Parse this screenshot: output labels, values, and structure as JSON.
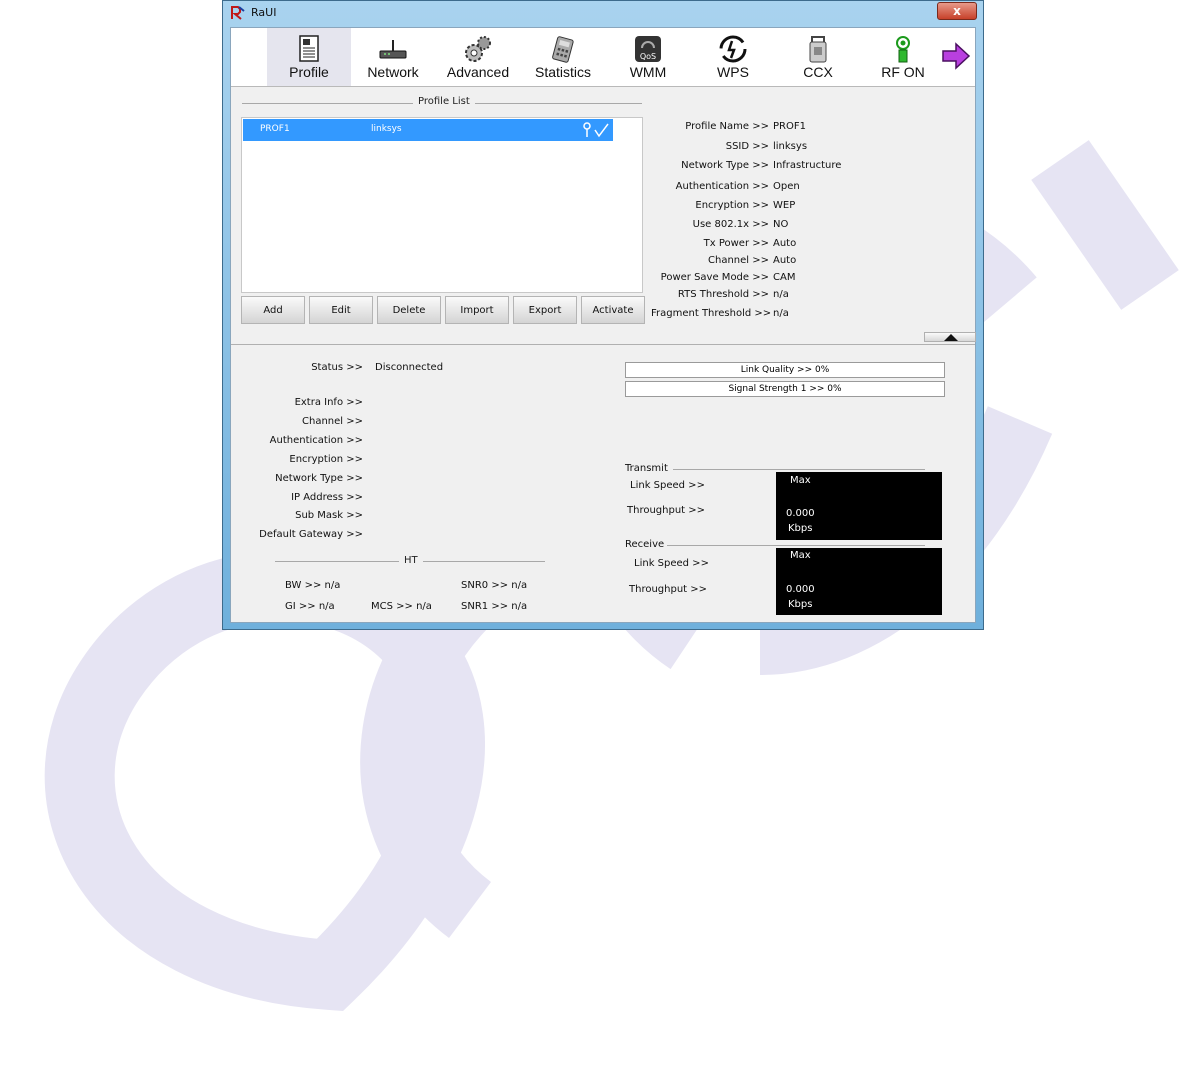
{
  "window": {
    "title": "RaUI",
    "close_glyph": "x"
  },
  "toolbar": [
    {
      "label": "Profile",
      "icon": "profile-icon",
      "active": true
    },
    {
      "label": "Network",
      "icon": "network-icon"
    },
    {
      "label": "Advanced",
      "icon": "advanced-icon"
    },
    {
      "label": "Statistics",
      "icon": "statistics-icon"
    },
    {
      "label": "WMM",
      "icon": "wmm-icon"
    },
    {
      "label": "WPS",
      "icon": "wps-icon"
    },
    {
      "label": "CCX",
      "icon": "ccx-icon"
    },
    {
      "label": "RF ON",
      "icon": "rf-on-icon"
    }
  ],
  "profile_list": {
    "title": "Profile List",
    "rows": [
      {
        "name": "PROF1",
        "ssid": "linksys"
      }
    ],
    "buttons": [
      "Add",
      "Edit",
      "Delete",
      "Import",
      "Export",
      "Activate"
    ]
  },
  "profile_details": [
    {
      "key": "Profile Name >>",
      "value": "PROF1"
    },
    {
      "key": "SSID >>",
      "value": "linksys"
    },
    {
      "key": "Network Type >>",
      "value": "Infrastructure"
    },
    {
      "key": "Authentication >>",
      "value": "Open"
    },
    {
      "key": "Encryption >>",
      "value": "WEP"
    },
    {
      "key": "Use 802.1x >>",
      "value": "NO"
    },
    {
      "key": "Tx Power >>",
      "value": "Auto"
    },
    {
      "key": "Channel >>",
      "value": "Auto"
    },
    {
      "key": "Power Save Mode >>",
      "value": "CAM"
    },
    {
      "key": "RTS Threshold >>",
      "value": "n/a"
    },
    {
      "key": "Fragment Threshold >>",
      "value": "n/a"
    }
  ],
  "status": {
    "status_label": "Status >>",
    "status_value": "Disconnected",
    "labels": [
      "Extra Info >>",
      "Channel >>",
      "Authentication >>",
      "Encryption >>",
      "Network Type >>",
      "IP Address >>",
      "Sub Mask >>",
      "Default Gateway >>"
    ]
  },
  "ht": {
    "title": "HT",
    "bw": "BW >> n/a",
    "snr0": "SNR0 >>  n/a",
    "gi": "GI >>  n/a",
    "mcs": "MCS >>  n/a",
    "snr1": "SNR1 >>  n/a"
  },
  "quality": {
    "link_quality": "Link Quality >> 0%",
    "signal_strength": "Signal Strength 1 >> 0%"
  },
  "transmit": {
    "title": "Transmit",
    "link_speed_label": "Link Speed >>",
    "throughput_label": "Throughput >>",
    "max": "Max",
    "value": "0.000",
    "unit": "Kbps"
  },
  "receive": {
    "title": "Receive",
    "link_speed_label": "Link Speed >>",
    "throughput_label": "Throughput >>",
    "max": "Max",
    "value": "0.000",
    "unit": "Kbps"
  },
  "watermark": "QCC"
}
